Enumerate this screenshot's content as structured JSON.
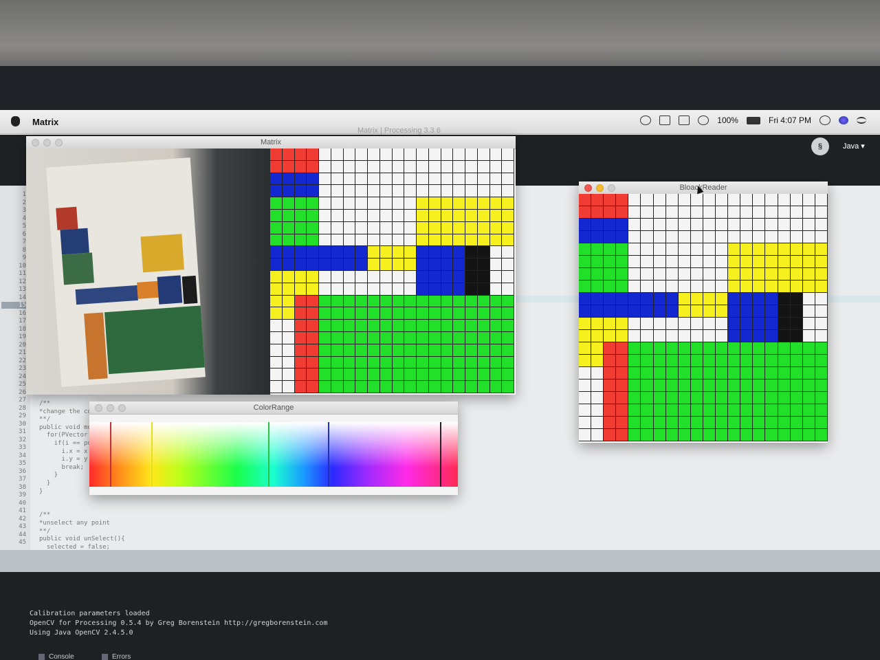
{
  "menubar": {
    "app_name": "Matrix",
    "battery": "100%",
    "clock": "Fri 4:07 PM",
    "icons": [
      "creative-cloud-icon",
      "glasses-icon",
      "airplay-icon",
      "wifi-icon",
      "battery-icon",
      "search-icon",
      "siri-icon",
      "list-icon"
    ]
  },
  "editor": {
    "title": "Matrix | Processing 3.3.6",
    "mode_label": "Java ▾",
    "current_line": "15",
    "code_lines": [
      "/**",
      "*change the co",
      "**/",
      "public void mo",
      "  for(PVector",
      "    if(i == po",
      "      i.x = x",
      "      i.y = y",
      "      break;",
      "    }",
      "  }",
      "}",
      "",
      "",
      "/**",
      "*unselect any point",
      "**/",
      "public void unSelect(){",
      "  selected = false;"
    ],
    "console_lines": [
      "Calibration parameters loaded",
      "OpenCV for Processing 0.5.4 by Greg Borenstein http://gregborenstein.com",
      "Using Java OpenCV 2.4.5.0"
    ],
    "console_tab": "Console",
    "errors_tab": "Errors"
  },
  "matrix_window": {
    "title": "Matrix"
  },
  "color_range_window": {
    "title": "ColorRange"
  },
  "block_reader_window": {
    "title": "BloackReader"
  },
  "colors": {
    "red": "#f03c32",
    "blue": "#1428d2",
    "green": "#22e02a",
    "yellow": "#f5f01e",
    "black": "#141414",
    "white": "#f4f4f4"
  }
}
